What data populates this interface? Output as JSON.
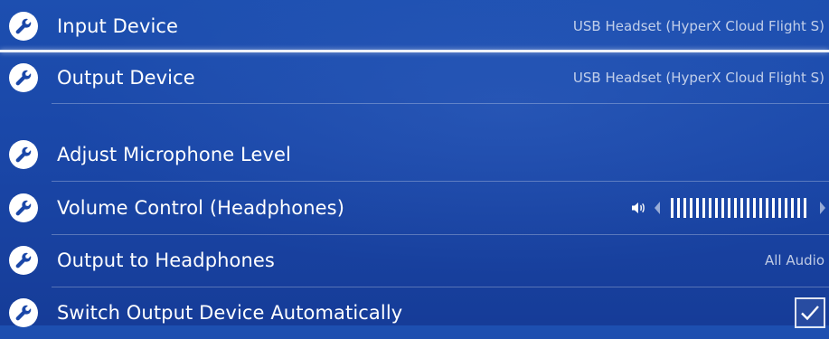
{
  "theme": {
    "background": "#1a47a8",
    "text": "#ffffff",
    "icon_bg": "#ffffff",
    "icon_fg": "#1a47a8"
  },
  "settings": [
    {
      "label": "Input Device",
      "value": "USB Headset (HyperX Cloud Flight S)",
      "icon": "wrench-icon",
      "focused": true
    },
    {
      "label": "Output Device",
      "value": "USB Headset (HyperX Cloud Flight S)",
      "icon": "wrench-icon"
    },
    {
      "label": "Adjust Microphone Level",
      "icon": "wrench-icon"
    },
    {
      "label": "Volume Control (Headphones)",
      "icon": "wrench-icon",
      "control": "slider",
      "volume_level": 1.0,
      "speaker_icon": "speaker-icon"
    },
    {
      "label": "Output to Headphones",
      "value": "All Audio",
      "icon": "wrench-icon"
    },
    {
      "label": "Switch Output Device Automatically",
      "icon": "wrench-icon",
      "control": "checkbox",
      "checked": true
    }
  ]
}
